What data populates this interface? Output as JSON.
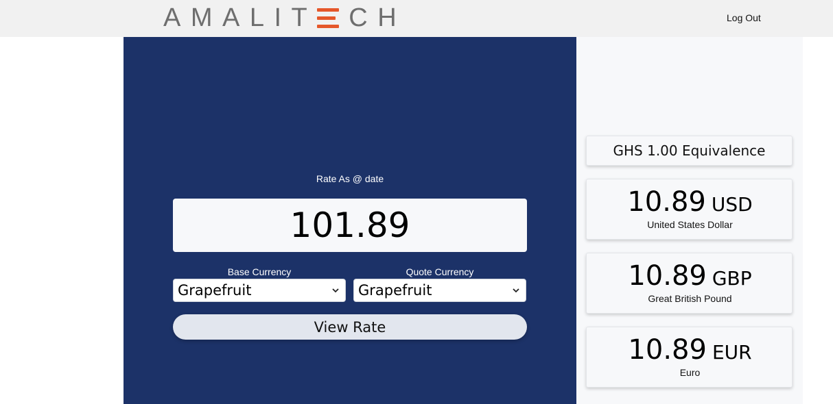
{
  "header": {
    "logo_text_left": "AMALIT",
    "logo_text_right": "CH",
    "logout_label": "Log Out",
    "brand_color": "#e5572a"
  },
  "converter": {
    "rate_label": "Rate As @ date",
    "rate_value": "101.89",
    "base_label": "Base Currency",
    "base_value": "Grapefruit",
    "quote_label": "Quote Currency",
    "quote_value": "Grapefruit",
    "view_button": "View Rate",
    "panel_color": "#1c3268"
  },
  "equivalence": {
    "title": "GHS 1.00 Equivalence",
    "items": [
      {
        "amount": "10.89",
        "code": "USD",
        "name": "United States Dollar"
      },
      {
        "amount": "10.89",
        "code": "GBP",
        "name": "Great British Pound"
      },
      {
        "amount": "10.89",
        "code": "EUR",
        "name": "Euro"
      }
    ]
  }
}
